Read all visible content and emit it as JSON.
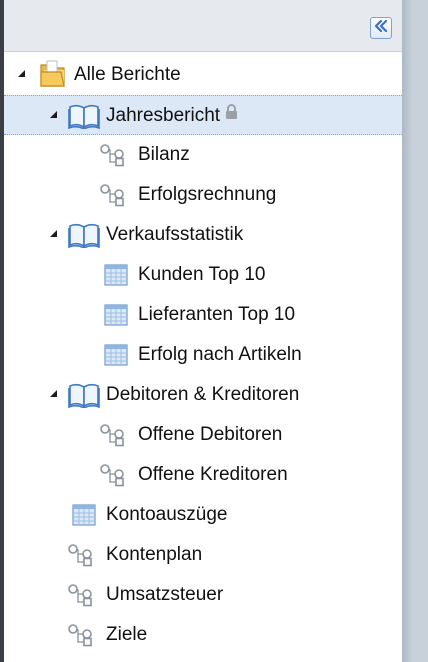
{
  "colors": {
    "selected_bg": "#dde8f6",
    "header_bg": "#e6e9ee",
    "accent": "#3b6fc4"
  },
  "header": {
    "collapse_icon": "double-chevron-left-icon"
  },
  "tree": {
    "root": {
      "label": "Alle Berichte",
      "icon": "folder-icon",
      "expanded": true
    },
    "jahresbericht": {
      "label": "Jahresbericht",
      "icon": "book-icon",
      "expanded": true,
      "locked": true,
      "selected": true,
      "children": [
        {
          "label": "Bilanz",
          "icon": "hierarchy-icon"
        },
        {
          "label": "Erfolgsrechnung",
          "icon": "hierarchy-icon"
        }
      ]
    },
    "verkaufsstatistik": {
      "label": "Verkaufsstatistik",
      "icon": "book-icon",
      "expanded": true,
      "children": [
        {
          "label": "Kunden Top 10",
          "icon": "table-icon"
        },
        {
          "label": "Lieferanten Top 10",
          "icon": "table-icon"
        },
        {
          "label": "Erfolg nach Artikeln",
          "icon": "table-icon"
        }
      ]
    },
    "debitoren": {
      "label": "Debitoren & Kreditoren",
      "icon": "book-icon",
      "expanded": true,
      "children": [
        {
          "label": "Offene Debitoren",
          "icon": "hierarchy-icon"
        },
        {
          "label": "Offene Kreditoren",
          "icon": "hierarchy-icon"
        }
      ]
    },
    "leaves": [
      {
        "label": "Kontoauszüge",
        "icon": "table-icon"
      },
      {
        "label": "Kontenplan",
        "icon": "hierarchy-icon"
      },
      {
        "label": "Umsatzsteuer",
        "icon": "hierarchy-icon"
      },
      {
        "label": "Ziele",
        "icon": "hierarchy-icon"
      }
    ]
  }
}
